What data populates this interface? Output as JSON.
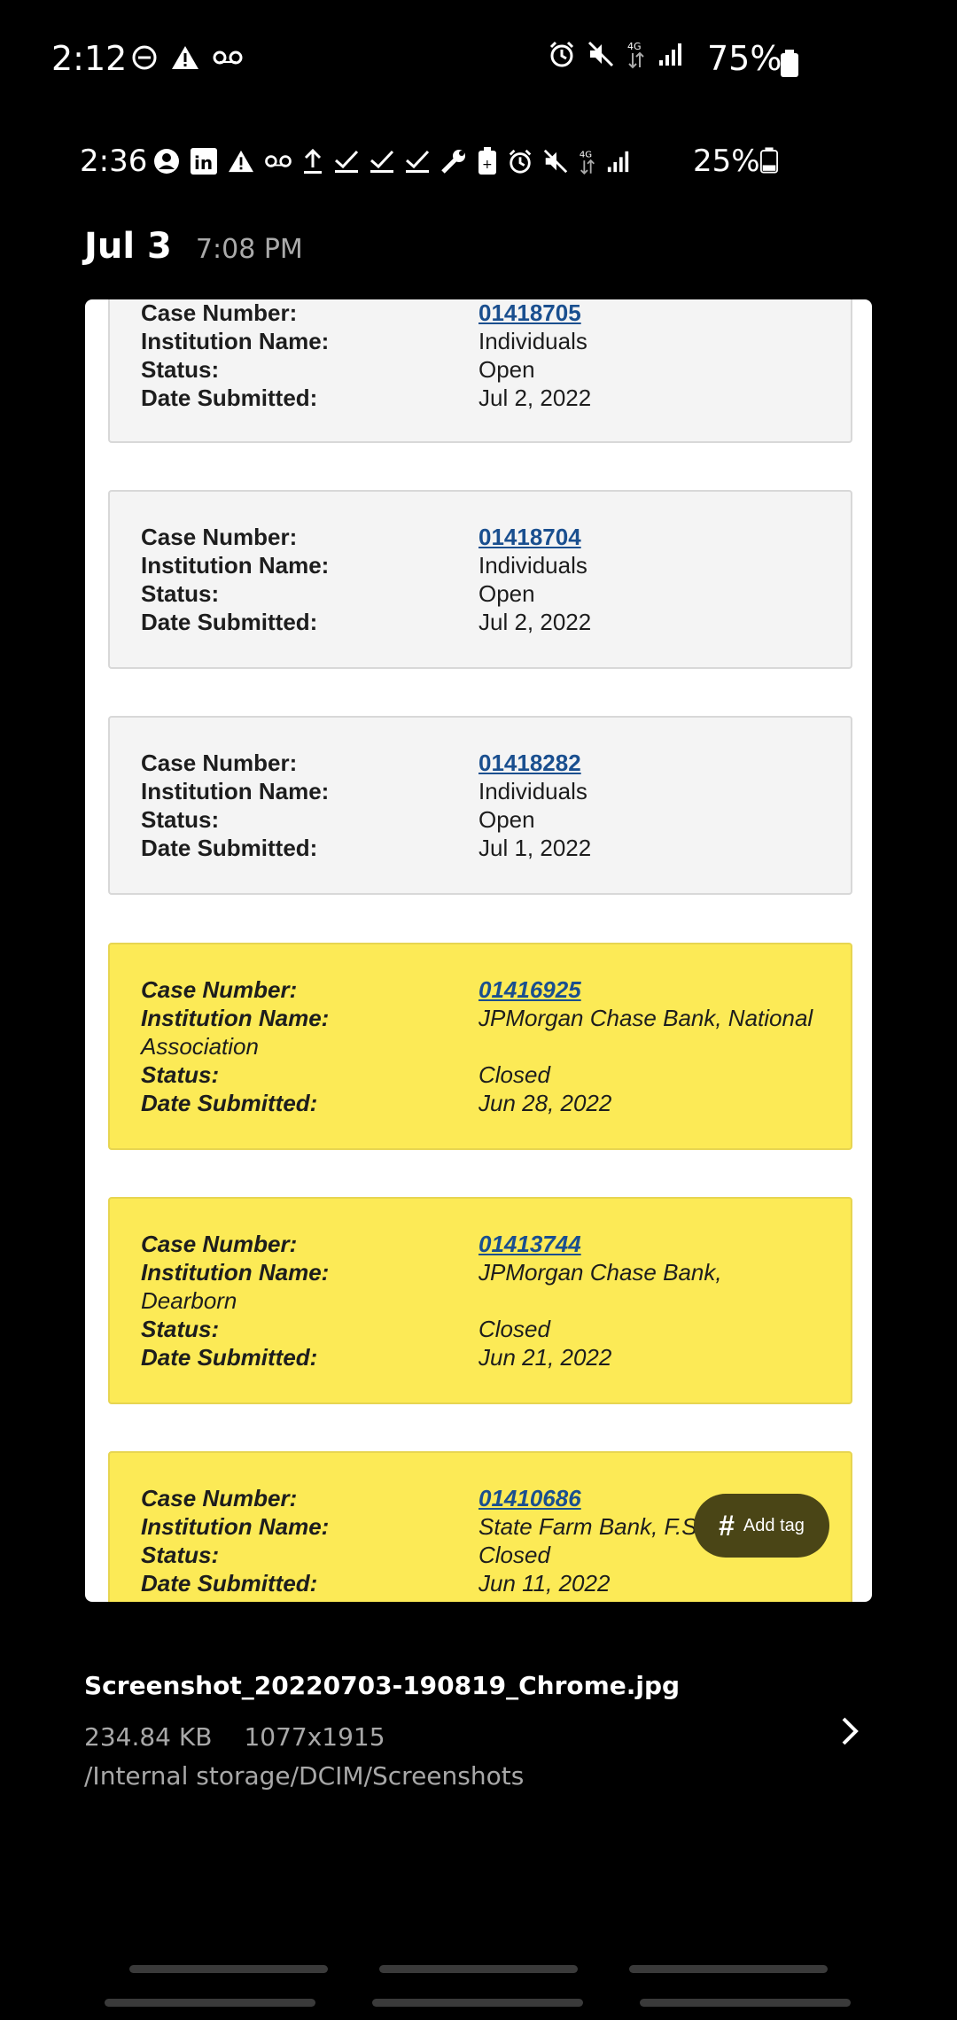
{
  "status_bar": {
    "time": "2:12",
    "battery": "75%"
  },
  "inner_status": {
    "time": "2:36",
    "battery": "25%"
  },
  "header": {
    "date": "Jul 3",
    "time": "7:08 PM"
  },
  "cards": [
    {
      "case_label": "Case Number:",
      "case_number": "01418705",
      "inst_label": "Institution Name:",
      "institution": "Individuals",
      "status_label": "Status:",
      "status": "Open",
      "date_label": "Date Submitted:",
      "date": "Jul 2, 2022"
    },
    {
      "case_label": "Case Number:",
      "case_number": "01418704",
      "inst_label": "Institution Name:",
      "institution": "Individuals",
      "status_label": "Status:",
      "status": "Open",
      "date_label": "Date Submitted:",
      "date": "Jul 2, 2022"
    },
    {
      "case_label": "Case Number:",
      "case_number": "01418282",
      "inst_label": "Institution Name:",
      "institution": "Individuals",
      "status_label": "Status:",
      "status": "Open",
      "date_label": "Date Submitted:",
      "date": "Jul 1, 2022"
    },
    {
      "case_label": "Case Number:",
      "case_number": "01416925",
      "inst_label": "Institution Name:",
      "institution": "JPMorgan Chase Bank, National",
      "institution_cont": "Association",
      "status_label": "Status:",
      "status": "Closed",
      "date_label": "Date Submitted:",
      "date": "Jun 28, 2022"
    },
    {
      "case_label": "Case Number:",
      "case_number": "01413744",
      "inst_label": "Institution Name:",
      "institution": "JPMorgan Chase Bank,",
      "institution_cont": "Dearborn",
      "status_label": "Status:",
      "status": "Closed",
      "date_label": "Date Submitted:",
      "date": "Jun 21, 2022"
    },
    {
      "case_label": "Case Number:",
      "case_number": "01410686",
      "inst_label": "Institution Name:",
      "institution": "State Farm Bank, F.S.B.",
      "status_label": "Status:",
      "status": "Closed",
      "date_label": "Date Submitted:",
      "date": "Jun 11, 2022"
    }
  ],
  "add_tag": {
    "label": "Add tag",
    "icon": "#"
  },
  "file_info": {
    "name": "Screenshot_20220703-190819_Chrome.jpg",
    "size": "234.84 KB",
    "dimensions": "1077x1915",
    "path": "/Internal storage/DCIM/Screenshots"
  }
}
